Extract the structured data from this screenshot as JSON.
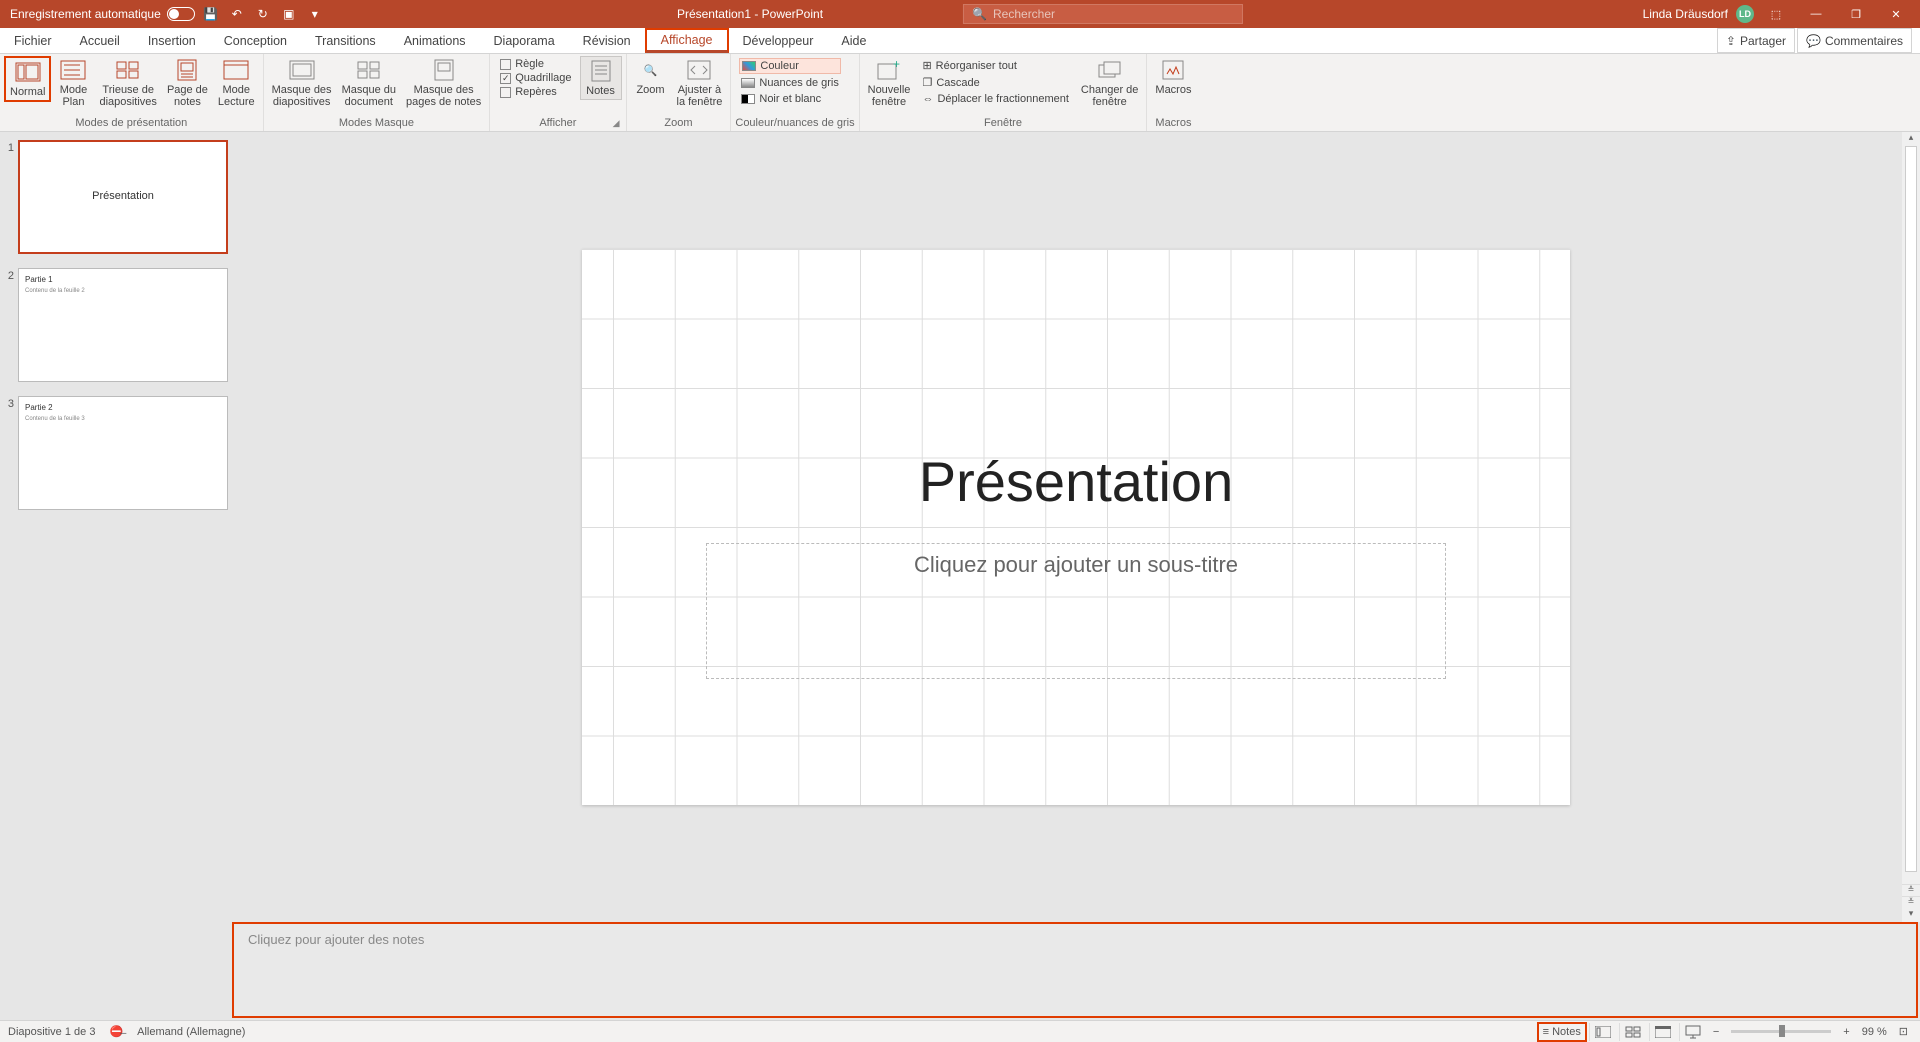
{
  "title_bar": {
    "autosave_label": "Enregistrement automatique",
    "doc_title": "Présentation1 - PowerPoint",
    "search_placeholder": "Rechercher",
    "user_name": "Linda Dräusdorf",
    "user_initials": "LD"
  },
  "tabs": {
    "items": [
      "Fichier",
      "Accueil",
      "Insertion",
      "Conception",
      "Transitions",
      "Animations",
      "Diaporama",
      "Révision",
      "Affichage",
      "Développeur",
      "Aide"
    ],
    "active": "Affichage",
    "share": "Partager",
    "comments": "Commentaires"
  },
  "ribbon": {
    "groups": {
      "presentation_views": {
        "label": "Modes de présentation",
        "normal": "Normal",
        "outline": "Mode\nPlan",
        "sorter": "Trieuse de\ndiapositives",
        "notes_page": "Page de\nnotes",
        "reading": "Mode\nLecture"
      },
      "master_views": {
        "label": "Modes Masque",
        "slide_master": "Masque des\ndiapositives",
        "handout_master": "Masque du\ndocument",
        "notes_master": "Masque des\npages de notes"
      },
      "show": {
        "label": "Afficher",
        "ruler": "Règle",
        "gridlines": "Quadrillage",
        "guides": "Repères",
        "notes": "Notes"
      },
      "zoom": {
        "label": "Zoom",
        "zoom": "Zoom",
        "fit": "Ajuster à\nla fenêtre"
      },
      "color": {
        "label": "Couleur/nuances de gris",
        "color": "Couleur",
        "grayscale": "Nuances de gris",
        "bw": "Noir et blanc"
      },
      "window": {
        "label": "Fenêtre",
        "new": "Nouvelle\nfenêtre",
        "arrange": "Réorganiser tout",
        "cascade": "Cascade",
        "split": "Déplacer le fractionnement",
        "switch": "Changer de\nfenêtre"
      },
      "macros": {
        "label": "Macros",
        "macros": "Macros"
      }
    }
  },
  "thumbnails": [
    {
      "num": "1",
      "title": "Présentation",
      "body": "",
      "selected": true,
      "layout": "title"
    },
    {
      "num": "2",
      "title": "Partie 1",
      "body": "Contenu de la feuille 2",
      "selected": false,
      "layout": "content"
    },
    {
      "num": "3",
      "title": "Partie 2",
      "body": "Contenu de la feuille 3",
      "selected": false,
      "layout": "content"
    }
  ],
  "slide": {
    "title": "Présentation",
    "subtitle_placeholder": "Cliquez pour ajouter un sous-titre"
  },
  "notes": {
    "placeholder": "Cliquez pour ajouter des notes"
  },
  "status": {
    "slide_info": "Diapositive 1 de 3",
    "language": "Allemand (Allemagne)",
    "notes_btn": "Notes",
    "zoom": "99 %"
  }
}
